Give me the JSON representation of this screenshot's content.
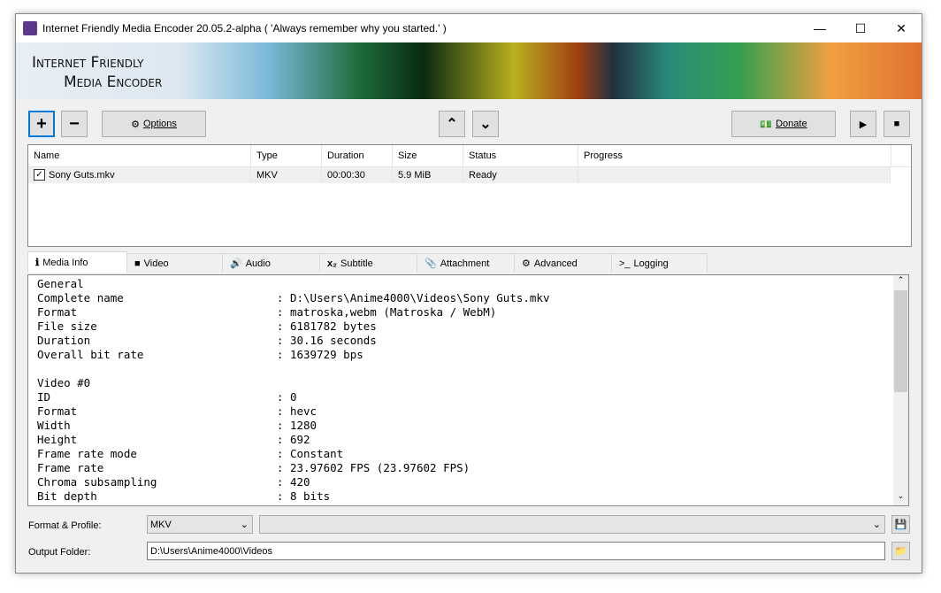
{
  "window": {
    "title": "Internet Friendly Media Encoder 20.05.2-alpha ( 'Always remember why you started.' )",
    "minimize": "—",
    "maximize": "☐",
    "close": "✕"
  },
  "banner": {
    "line1": "Internet Friendly",
    "line2": "Media Encoder"
  },
  "toolbar": {
    "add": "+",
    "remove": "−",
    "options": "Options",
    "up": "⌃",
    "down": "⌄",
    "donate": "Donate",
    "start": "▶",
    "stop": "■"
  },
  "queue": {
    "columns": [
      "Name",
      "Type",
      "Duration",
      "Size",
      "Status",
      "Progress"
    ],
    "rows": [
      {
        "checked": true,
        "name": "Sony Guts.mkv",
        "type": "MKV",
        "duration": "00:00:30",
        "size": "5.9 MiB",
        "status": "Ready",
        "progress": ""
      }
    ]
  },
  "tabs": [
    {
      "icon": "info-icon",
      "glyph": "ℹ",
      "label": "Media Info"
    },
    {
      "icon": "video-camera-icon",
      "glyph": "■",
      "label": "Video"
    },
    {
      "icon": "speaker-icon",
      "glyph": "🔊",
      "label": "Audio"
    },
    {
      "icon": "subscript-icon",
      "glyph": "x₂",
      "label": "Subtitle"
    },
    {
      "icon": "paperclip-icon",
      "glyph": "📎",
      "label": "Attachment"
    },
    {
      "icon": "gear-icon",
      "glyph": "⚙",
      "label": "Advanced"
    },
    {
      "icon": "terminal-icon",
      "glyph": ">_",
      "label": "Logging"
    }
  ],
  "media_info": "General\nComplete name                       : D:\\Users\\Anime4000\\Videos\\Sony Guts.mkv\nFormat                              : matroska,webm (Matroska / WebM)\nFile size                           : 6181782 bytes\nDuration                            : 30.16 seconds\nOverall bit rate                    : 1639729 bps\n\nVideo #0\nID                                  : 0\nFormat                              : hevc\nWidth                               : 1280\nHeight                              : 692\nFrame rate mode                     : Constant\nFrame rate                          : 23.97602 FPS (23.97602 FPS)\nChroma subsampling                  : 420\nBit depth                           : 8 bits",
  "format": {
    "label": "Format & Profile:",
    "format_value": "MKV",
    "profile_value": ""
  },
  "output": {
    "label": "Output Folder:",
    "value": "D:\\Users\\Anime4000\\Videos"
  }
}
